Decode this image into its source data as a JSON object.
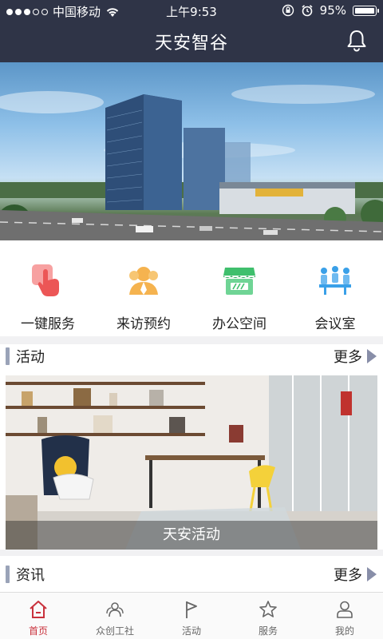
{
  "status_bar": {
    "carrier": "中国移动",
    "time": "上午9:53",
    "battery": "95%",
    "signal_level": 0.6
  },
  "header": {
    "title": "天安智谷",
    "bell_icon": "bell-icon"
  },
  "quick_actions": [
    {
      "label": "一键服务",
      "icon": "tap-hand-icon",
      "color": "#f06b6b"
    },
    {
      "label": "来访预约",
      "icon": "visitor-icon",
      "color": "#f5b34f"
    },
    {
      "label": "办公空间",
      "icon": "shop-awning-icon",
      "color": "#3fbf6d"
    },
    {
      "label": "会议室",
      "icon": "meeting-icon",
      "color": "#3aa0e8"
    }
  ],
  "activities": {
    "title": "活动",
    "more": "更多",
    "card_caption": "天安活动"
  },
  "news": {
    "title": "资讯",
    "more": "更多"
  },
  "tabbar": [
    {
      "label": "首页",
      "icon": "home-icon",
      "active": true
    },
    {
      "label": "众创工社",
      "icon": "community-icon",
      "active": false
    },
    {
      "label": "活动",
      "icon": "flag-icon",
      "active": false
    },
    {
      "label": "服务",
      "icon": "star-icon",
      "active": false
    },
    {
      "label": "我的",
      "icon": "user-icon",
      "active": false
    }
  ],
  "colors": {
    "header_bg": "#2f3447",
    "accent": "#c9313c",
    "section_bar": "#9aa3b8"
  }
}
